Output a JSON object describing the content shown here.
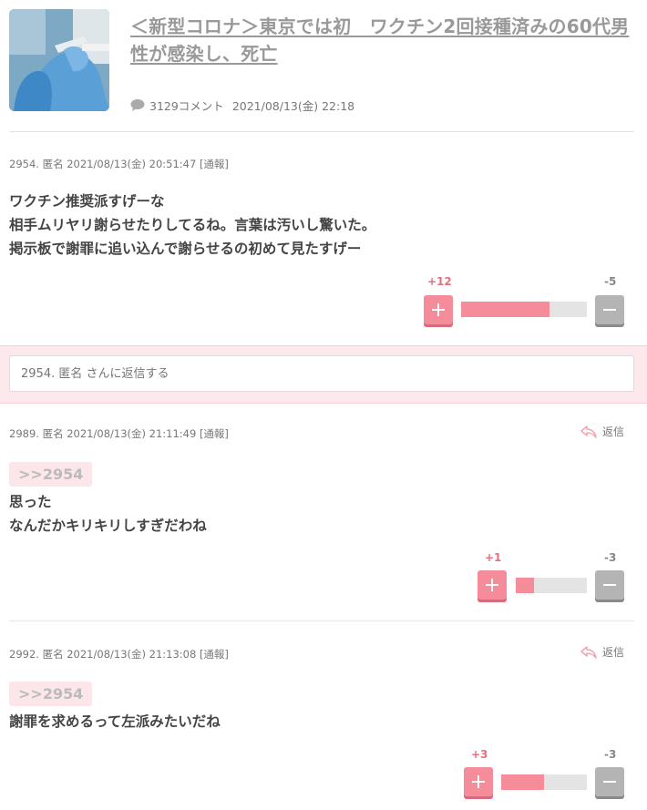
{
  "article": {
    "title": "＜新型コロナ＞東京では初　ワクチン2回接種済みの60代男性が感染し、死亡",
    "comment_count": "3129コメント",
    "date": "2021/08/13(金) 22:18"
  },
  "comments": [
    {
      "header": "2954. 匿名 2021/08/13(金) 20:51:47 [通報]",
      "anchor": "",
      "lines": [
        "ワクチン推奨派すげーな",
        "相手ムリヤリ謝らせたりしてるね。言葉は汚いし驚いた。",
        "掲示板で謝罪に追い込んで謝らせるの初めて見たすげー"
      ],
      "plus": "+12",
      "minus": "-5",
      "plus_ratio": 0.705
    },
    {
      "header": "2989. 匿名 2021/08/13(金) 21:11:49 [通報]",
      "reply_label": "返信",
      "anchor": ">>2954",
      "lines": [
        "思った",
        "なんだかキリキリしすぎだわね"
      ],
      "plus": "+1",
      "minus": "-3",
      "plus_ratio": 0.25
    },
    {
      "header": "2992. 匿名 2021/08/13(金) 21:13:08 [通報]",
      "reply_label": "返信",
      "anchor": ">>2954",
      "lines": [
        "謝罪を求めるって左派みたいだね"
      ],
      "plus": "+3",
      "minus": "-3",
      "plus_ratio": 0.5
    }
  ],
  "reply_box": {
    "placeholder": "2954. 匿名 さんに返信する"
  }
}
